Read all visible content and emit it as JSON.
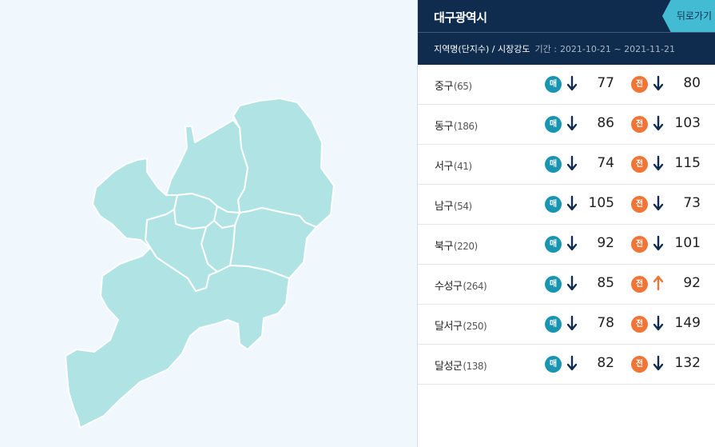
{
  "header": {
    "city": "대구광역시",
    "back_label": "뒤로가기"
  },
  "subheader": {
    "region_label": "지역명(단지수) / 시장강도",
    "period_label": "기간 :",
    "period": "2021-10-21 ~ 2021-11-21"
  },
  "badges": {
    "sale": "매",
    "jeonse": "전"
  },
  "colors": {
    "accent": "#43bcd3",
    "header_bg": "#0f2c4f",
    "map_fill": "#b0e3e3",
    "sale_badge": "#1a95b1",
    "jeonse_badge": "#f07536",
    "arrow_down": "#0f2c4f",
    "arrow_up": "#f07536"
  },
  "districts": [
    {
      "name": "중구",
      "count": "(65)",
      "sale_value": "77",
      "sale_trend": "down",
      "jeonse_value": "80",
      "jeonse_trend": "down"
    },
    {
      "name": "동구",
      "count": "(186)",
      "sale_value": "86",
      "sale_trend": "down",
      "jeonse_value": "103",
      "jeonse_trend": "down"
    },
    {
      "name": "서구",
      "count": "(41)",
      "sale_value": "74",
      "sale_trend": "down",
      "jeonse_value": "115",
      "jeonse_trend": "down"
    },
    {
      "name": "남구",
      "count": "(54)",
      "sale_value": "105",
      "sale_trend": "down",
      "jeonse_value": "73",
      "jeonse_trend": "down"
    },
    {
      "name": "북구",
      "count": "(220)",
      "sale_value": "92",
      "sale_trend": "down",
      "jeonse_value": "101",
      "jeonse_trend": "down"
    },
    {
      "name": "수성구",
      "count": "(264)",
      "sale_value": "85",
      "sale_trend": "down",
      "jeonse_value": "92",
      "jeonse_trend": "up"
    },
    {
      "name": "달서구",
      "count": "(250)",
      "sale_value": "78",
      "sale_trend": "down",
      "jeonse_value": "149",
      "jeonse_trend": "down"
    },
    {
      "name": "달성군",
      "count": "(138)",
      "sale_value": "82",
      "sale_trend": "down",
      "jeonse_value": "132",
      "jeonse_trend": "down"
    }
  ]
}
